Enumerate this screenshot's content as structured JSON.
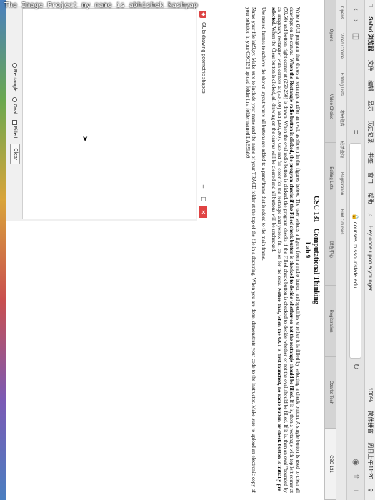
{
  "overlay": {
    "caption": "The Image Project my name is abhishek kashyap"
  },
  "menubar": {
    "app_name": "Safari 浏览器",
    "items": [
      "文件",
      "编辑",
      "显示",
      "历史记录",
      "书签",
      "窗口",
      "帮助"
    ],
    "now_playing": "Hey once upon a younger",
    "battery": "100%",
    "input_method": "简体拼音",
    "clock": "周日上午11:26"
  },
  "toolbar": {
    "address": "courses.missouristate.edu"
  },
  "bookmarks": [
    "Opens",
    "Video Choice",
    "Editing Lists",
    "考研题库",
    "成绩查询",
    "Registration",
    "Find Courses"
  ],
  "tabs": [
    {
      "label": "Opens",
      "active": false
    },
    {
      "label": "Video Choice",
      "active": false
    },
    {
      "label": "Editing Lists",
      "active": false
    },
    {
      "label": "课程中心",
      "active": false
    },
    {
      "label": "Registration",
      "active": false
    },
    {
      "label": "Ozarks Tech",
      "active": false
    },
    {
      "label": "CSC 131",
      "active": true
    }
  ],
  "document": {
    "title": "CSC 131 - Computational Thinking",
    "subtitle": "Lab 9",
    "p1_a": "Write a GUI program that draws a rectangle and/or an oval, as shown in the figures below. The user selects a figure from a radio button and specifies whether it is filled by selecting a check button. A single button is used to clear all drawings on the canvas. ",
    "p1_b": "When the Rectangle radio button is clicked, the program checks if the Filled check button is checked to decide whether or not the rectangle should be filled.",
    "p1_c": " If it is, then a rectangle with top left corner at (50,50) and bottom right corner at (250,250) is drawn. When the oval radio button is clicked, the program checks if the Filled check button is checked to decide whether or not the oval should be filled. If it is, then an oval \"bounded by an imaginary rectangle\" with corners at (50,100) and (250,200). Use red fill color for the rectangle and yellow fill color for the oval. ",
    "p1_d": "Notice that, when the GUI is first launched, no radio button or check button is initially pre-selected.",
    "p1_e": " When the Clear button is clicked, all drawing on the canvas will be cleared and all buttons will be unchecked.",
    "p2": "Use nested frames to achieve the shown layout where all buttons are added to a pane/frame that is added to the main frame.",
    "p3": "Name your file lab9.py. Make sure to include your name and the name of your TRACE folder at the top of the file in a docstring. When you are done, demonstrate your code to the instructor. Make sure to upload an electronic copy of your solution in your CSC131 upload folder in a folder named LAB9lab9."
  },
  "app_window": {
    "title": "GUIs drawing geometric shapes",
    "minimize": "–",
    "maximize": "☐",
    "close": "✕",
    "controls": {
      "rectangle": "Rectangle",
      "oval": "Oval",
      "filled": "Filled",
      "clear": "Clear"
    }
  }
}
